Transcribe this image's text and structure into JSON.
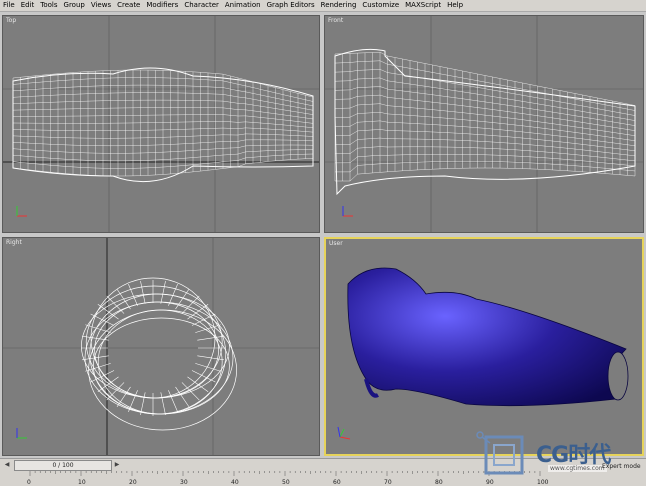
{
  "menu": [
    "File",
    "Edit",
    "Tools",
    "Group",
    "Views",
    "Create",
    "Modifiers",
    "Character",
    "Animation",
    "Graph Editors",
    "Rendering",
    "Customize",
    "MAXScript",
    "Help"
  ],
  "viewports": {
    "top": {
      "label": "Top"
    },
    "front": {
      "label": "Front"
    },
    "right": {
      "label": "Right"
    },
    "user": {
      "label": "User"
    }
  },
  "timeline": {
    "frame_display": "0 / 100",
    "ticks": [
      "0",
      "10",
      "20",
      "30",
      "40",
      "50",
      "60",
      "70",
      "80",
      "90",
      "100"
    ]
  },
  "watermark": {
    "brand": "CG时代",
    "url": "www.cgtimes.com"
  },
  "status": {
    "corner_text": "Expert mode"
  },
  "colors": {
    "viewport_bg": "#7d7d7d",
    "wireframe": "#ffffff",
    "active_border": "#e6d35a",
    "shaded_object": "#2a1f9e",
    "grid_dark": "#3a3a3a"
  },
  "icons": {
    "axis_gizmo": "axis-tripod-icon",
    "logo": "cg-logo-icon"
  }
}
